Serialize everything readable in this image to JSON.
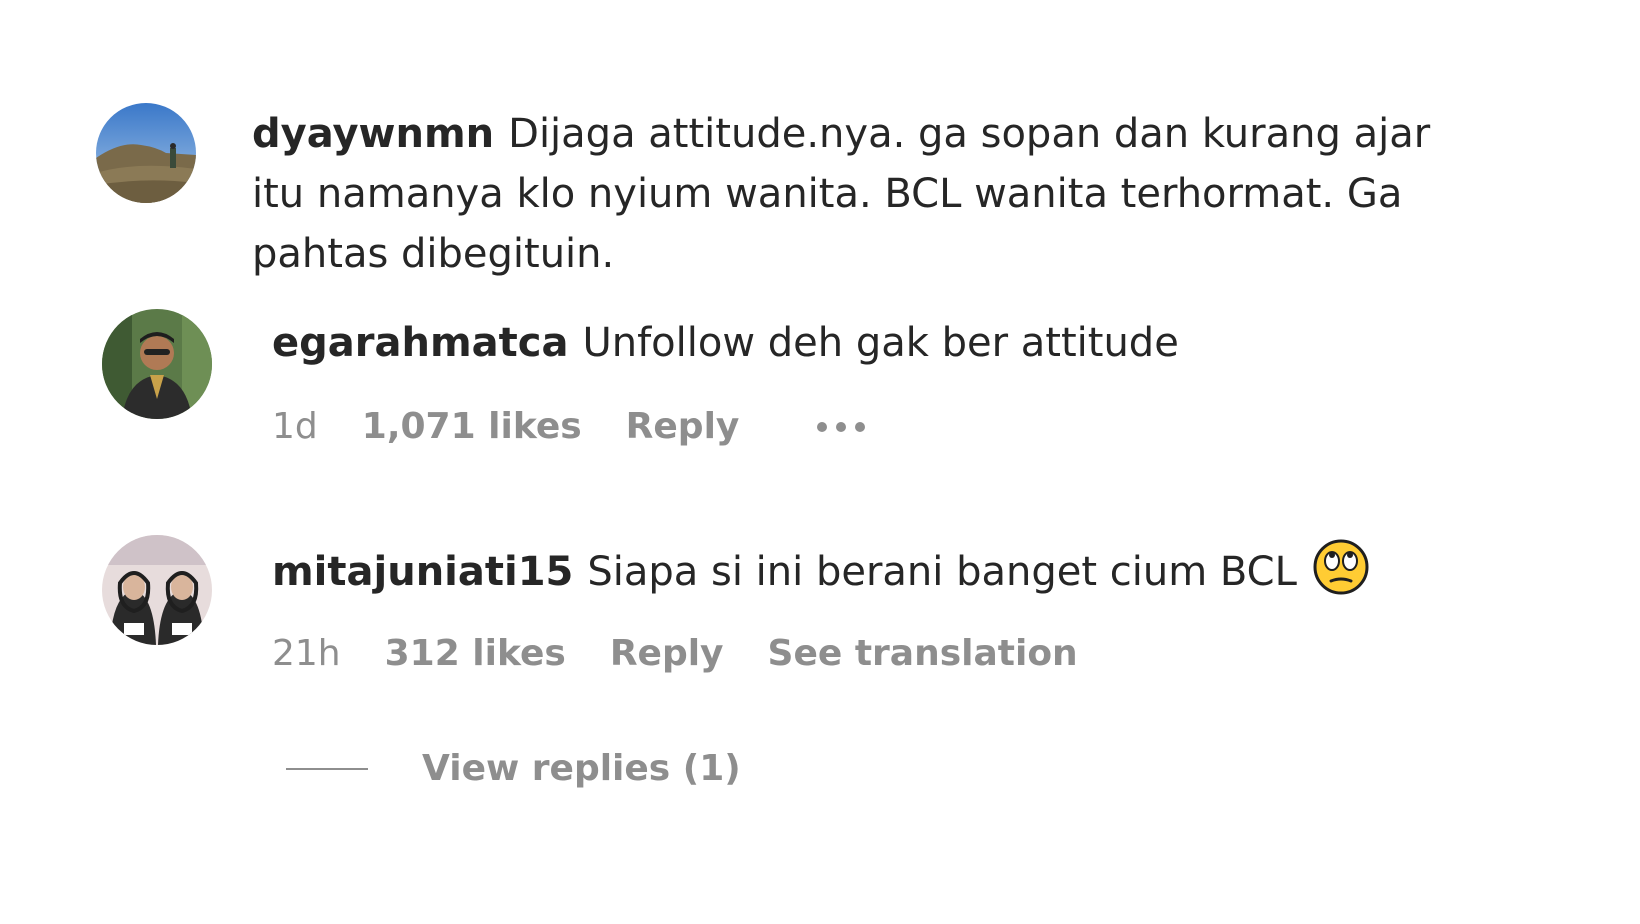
{
  "comments": [
    {
      "username": "dyaywnmn",
      "text": "Dijaga attitude.nya. ga sopan dan kurang ajar itu namanya klo nyium wanita. BCL wanita terhormat. Ga pahtas dibegituin."
    },
    {
      "username": "egarahmatca",
      "text": "Unfollow deh gak ber attitude",
      "time": "1d",
      "likes": "1,071 likes",
      "reply": "Reply",
      "more_icon": "more-options-icon"
    },
    {
      "username": "mitajuniati15",
      "text": "Siapa si ini berani banget cium BCL",
      "emoji": "eye-roll-emoji-icon",
      "time": "21h",
      "likes": "312 likes",
      "reply": "Reply",
      "translate": "See translation"
    }
  ],
  "view_replies": "View replies (1)",
  "colors": {
    "text": "#262626",
    "muted": "#8e8e8e"
  }
}
